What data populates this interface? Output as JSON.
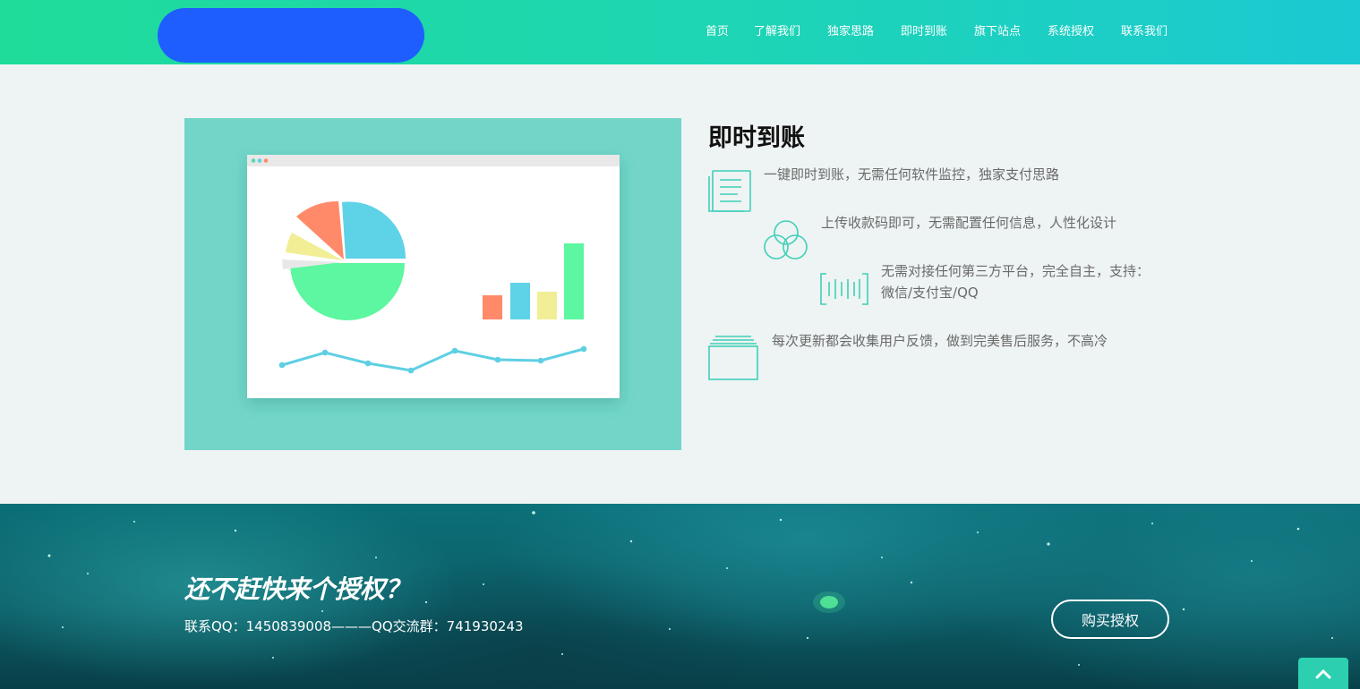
{
  "header": {
    "nav": [
      {
        "label": "首页"
      },
      {
        "label": "了解我们"
      },
      {
        "label": "独家思路"
      },
      {
        "label": "即时到账"
      },
      {
        "label": "旗下站点"
      },
      {
        "label": "系统授权"
      },
      {
        "label": "联系我们"
      }
    ]
  },
  "section": {
    "title": "即时到账",
    "features": [
      {
        "icon": "document-list-icon",
        "text": "一键即时到账，无需任何软件监控，独家支付思路"
      },
      {
        "icon": "overlapping-circles-icon",
        "text": "上传收款码即可，无需配置任何信息，人性化设计"
      },
      {
        "icon": "barcode-icon",
        "text": "无需对接任何第三方平台，完全自主，支持：",
        "text2": "微信/支付宝/QQ"
      },
      {
        "icon": "stacked-folders-icon",
        "text": "每次更新都会收集用户反馈，做到完美售后服务，不高冷"
      }
    ]
  },
  "banner": {
    "title": "还不赶快来个授权？",
    "subtitle": "联系QQ：1450839008———QQ交流群：741930243",
    "buy_button": "购买授权",
    "back_to_top_icon": "chevron-up-icon"
  },
  "colors": {
    "header_start": "#1fdc9a",
    "header_end": "#1bc9d2",
    "logo": "#1e5eff",
    "accent": "#2cd0b0"
  }
}
